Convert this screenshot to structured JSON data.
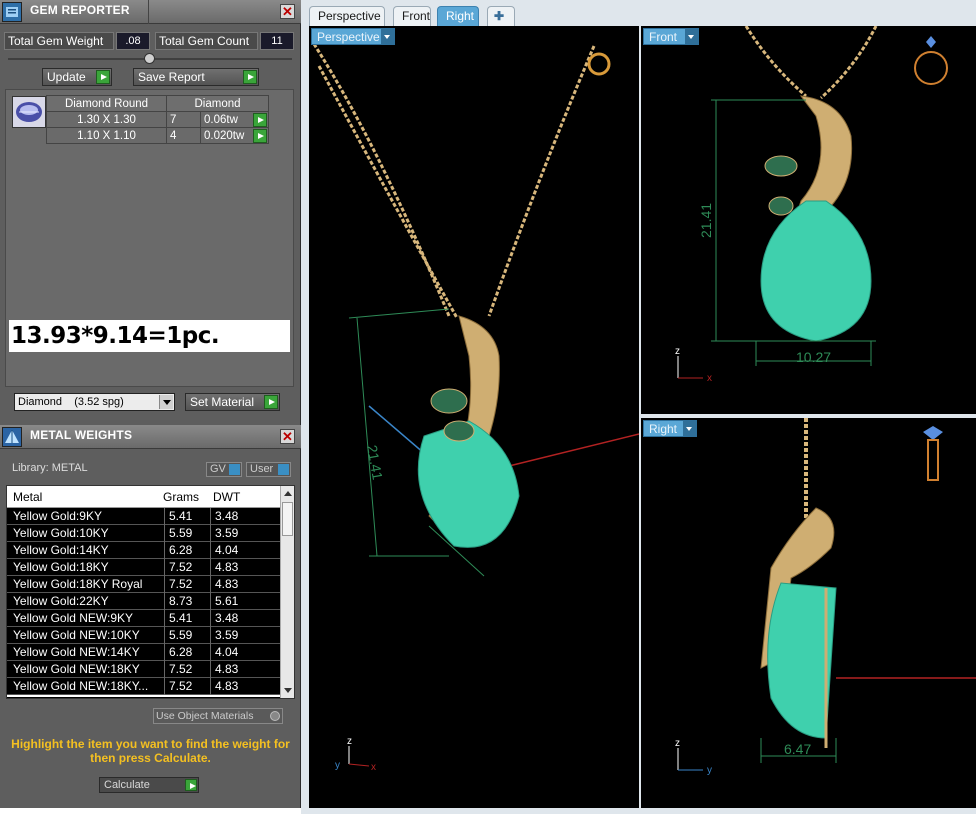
{
  "gem_reporter": {
    "title": "GEM REPORTER",
    "total_weight_label": "Total Gem Weight",
    "total_weight_value": ".08",
    "total_count_label": "Total Gem Count",
    "total_count_value": "11",
    "update_label": "Update",
    "save_report_label": "Save Report",
    "table_headers": [
      "Diamond Round",
      "Diamond"
    ],
    "rows": [
      {
        "size": "1.30 X 1.30",
        "count": "7",
        "weight": "0.06tw"
      },
      {
        "size": "1.10 X 1.10",
        "count": "4",
        "weight": "0.020tw"
      }
    ],
    "note": "13.93*9.14=1pc.",
    "material_select": "Diamond    (3.52 spg)",
    "set_material_label": "Set Material"
  },
  "metal_weights": {
    "title": "METAL WEIGHTS",
    "library_label": "Library: METAL",
    "gv_label": "GV",
    "user_label": "User",
    "columns": [
      "Metal",
      "Grams",
      "DWT"
    ],
    "rows": [
      {
        "metal": "Yellow Gold:9KY",
        "grams": "5.41",
        "dwt": "3.48"
      },
      {
        "metal": "Yellow Gold:10KY",
        "grams": "5.59",
        "dwt": "3.59"
      },
      {
        "metal": "Yellow Gold:14KY",
        "grams": "6.28",
        "dwt": "4.04"
      },
      {
        "metal": "Yellow Gold:18KY",
        "grams": "7.52",
        "dwt": "4.83"
      },
      {
        "metal": "Yellow Gold:18KY Royal",
        "grams": "7.52",
        "dwt": "4.83"
      },
      {
        "metal": "Yellow Gold:22KY",
        "grams": "8.73",
        "dwt": "5.61"
      },
      {
        "metal": "Yellow Gold NEW:9KY",
        "grams": "5.41",
        "dwt": "3.48"
      },
      {
        "metal": "Yellow Gold NEW:10KY",
        "grams": "5.59",
        "dwt": "3.59"
      },
      {
        "metal": "Yellow Gold NEW:14KY",
        "grams": "6.28",
        "dwt": "4.04"
      },
      {
        "metal": "Yellow Gold NEW:18KY",
        "grams": "7.52",
        "dwt": "4.83"
      },
      {
        "metal": "Yellow Gold NEW:18KY...",
        "grams": "7.52",
        "dwt": "4.83"
      }
    ],
    "use_object_materials_label": "Use Object Materials",
    "hint": "Highlight the item you want to find the weight for then press Calculate.",
    "calculate_label": "Calculate"
  },
  "viewports": {
    "tabs": [
      "Perspective",
      "Front",
      "Right"
    ],
    "active_tab": "Right",
    "plus_icon": "plus-icon",
    "perspective": {
      "label": "Perspective",
      "dim_height": "21.41"
    },
    "front": {
      "label": "Front",
      "dim_height": "21.41",
      "dim_width": "10.27",
      "axis_z": "z",
      "axis_x": "x"
    },
    "right": {
      "label": "Right",
      "dim_width": "6.47",
      "axis_z": "z",
      "axis_y": "y"
    },
    "persp_axis_z": "z",
    "persp_axis_y": "y",
    "persp_axis_x": "x",
    "colors": {
      "viewport_bg": "#000000",
      "gem": "#3fd0ad",
      "gold": "#e0c184",
      "dimension": "#2e8b57",
      "active_tab": "#5aa7d6"
    }
  }
}
